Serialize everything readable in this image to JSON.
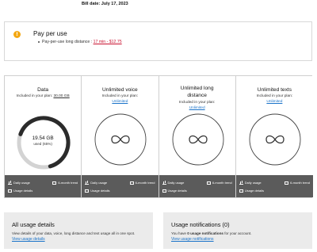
{
  "bill_date": "Bill date: July 17, 2023",
  "pay_per_use": {
    "icon": "alert-icon",
    "icon_color": "#f3a712",
    "title": "Pay per use",
    "line_label": "Pay-per-use long distance :",
    "line_value": "17 min - $12.75"
  },
  "usage": {
    "data": {
      "title": "Data",
      "plan_text": "Included in your plan:",
      "plan_value": "30.00 GB",
      "used_value": "19.54 GB",
      "used_pct_text": "used (65%)",
      "used_fraction": 0.65,
      "footer": {
        "daily": "Daily usage",
        "trend": "6-month trend",
        "details": "Usage details"
      }
    },
    "voice": {
      "title": "Unlimited voice",
      "plan_text": "Included in your plan:",
      "plan_link": "Unlimited",
      "footer": {
        "daily": "Daily usage",
        "trend": "6-month trend",
        "details": "Usage details"
      }
    },
    "long_distance": {
      "title": "Unlimited long distance",
      "plan_text": "Included in your plan:",
      "plan_link": "Unlimited",
      "footer": {
        "daily": "Daily usage",
        "trend": "6-month trend",
        "details": "Usage details"
      }
    },
    "texts": {
      "title": "Unlimited texts",
      "plan_text": "Included in your plan:",
      "plan_link": "Unlimited",
      "footer": {
        "daily": "Daily usage",
        "trend": "6-month trend",
        "details": "Usage details"
      }
    }
  },
  "all_usage": {
    "title": "All usage details",
    "text": "View details of your data, voice, long distance and text usage all in one spot.",
    "link": "View usage details"
  },
  "notifications": {
    "title": "Usage notifications (0)",
    "text_prefix": "You have",
    "text_bold": "0 usage notifications",
    "text_suffix": "for your account.",
    "link": "View usage notifications"
  },
  "colors": {
    "accent_link": "#1a73c9",
    "alert": "#c8102e",
    "footer_bar": "#5b5b5b",
    "gauge_fill": "#2b2b2b",
    "gauge_track": "#d3d3d3"
  }
}
